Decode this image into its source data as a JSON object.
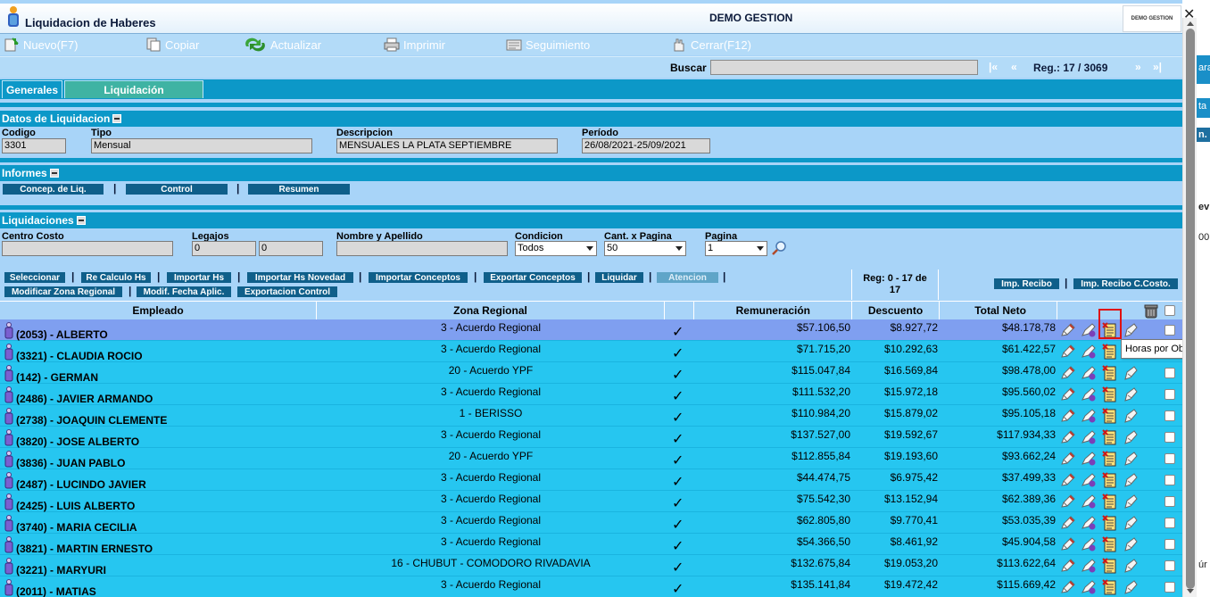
{
  "app": {
    "title": "Liquidacion de Haberes",
    "center_title": "DEMO GESTION",
    "brand": "DEMO GESTION"
  },
  "toolbar": [
    {
      "label": "Nuevo(F7)",
      "icon": "new-icon"
    },
    {
      "label": "Copiar",
      "icon": "copy-icon"
    },
    {
      "label": "Actualizar",
      "icon": "refresh-icon"
    },
    {
      "label": "Imprimir",
      "icon": "printer-icon"
    },
    {
      "label": "Seguimiento",
      "icon": "tracking-icon"
    },
    {
      "label": "Cerrar(F12)",
      "icon": "close-hand-icon"
    }
  ],
  "search": {
    "label": "Buscar",
    "value": "",
    "first": "|«",
    "prev": "«",
    "next": "»",
    "last": "»|",
    "reg": "Reg.: 17 / 3069"
  },
  "tabs": [
    "Generales",
    "Liquidación"
  ],
  "datos": {
    "header": "Datos de Liquidacion",
    "codigo_label": "Codigo",
    "codigo": "3301",
    "tipo_label": "Tipo",
    "tipo": "Mensual",
    "descripcion_label": "Descripcion",
    "descripcion": "MENSUALES LA PLATA SEPTIEMBRE",
    "periodo_label": "Período",
    "periodo": "26/08/2021-25/09/2021"
  },
  "informes": {
    "header": "Informes",
    "buttons": [
      "Concep. de Liq.",
      "Control",
      "Resumen"
    ],
    "sep": "|"
  },
  "liquidaciones": {
    "header": "Liquidaciones",
    "centro_costo_label": "Centro Costo",
    "centro_costo": "",
    "legajos_label": "Legajos",
    "legajo_desde": "0",
    "legajo_hasta": "0",
    "nombre_label": "Nombre y Apellido",
    "nombre": "",
    "condicion_label": "Condicion",
    "condicion": "Todos",
    "cant_label": "Cant. x Pagina",
    "cant": "50",
    "pagina_label": "Pagina",
    "pagina": "1"
  },
  "actions": {
    "row1": [
      "Seleccionar",
      "Re Calculo Hs",
      "Importar Hs",
      "Importar Hs Novedad",
      "Importar Conceptos",
      "Exportar Conceptos",
      "Liquidar",
      "Atencion"
    ],
    "row2": [
      "Modificar Zona Regional",
      "Modif. Fecha Aplic.",
      "Exportacion Control"
    ],
    "reg_line1": "Reg: 0 - 17 de",
    "reg_line2": "17",
    "recibo": "Imp. Recibo",
    "recibo_cc": "Imp. Recibo C.Costo."
  },
  "table": {
    "headers": {
      "empleado": "Empleado",
      "zona": "Zona Regional",
      "remuneracion": "Remuneración",
      "descuento": "Descuento",
      "total": "Total Neto"
    },
    "rows": [
      {
        "empleado": "(2053) - ALBERTO",
        "zona": "3 - Acuerdo Regional",
        "remuneracion": "$57.106,50",
        "descuento": "$8.927,72",
        "total": "$48.178,78"
      },
      {
        "empleado": "(3321) - CLAUDIA ROCIO",
        "zona": "3 - Acuerdo Regional",
        "remuneracion": "$71.715,20",
        "descuento": "$10.292,63",
        "total": "$61.422,57"
      },
      {
        "empleado": "(142) - GERMAN",
        "zona": "20 - Acuerdo YPF",
        "remuneracion": "$115.047,84",
        "descuento": "$16.569,84",
        "total": "$98.478,00"
      },
      {
        "empleado": "(2486) - JAVIER ARMANDO",
        "zona": "3 - Acuerdo Regional",
        "remuneracion": "$111.532,20",
        "descuento": "$15.972,18",
        "total": "$95.560,02"
      },
      {
        "empleado": "(2738) - JOAQUIN CLEMENTE",
        "zona": "1 - BERISSO",
        "remuneracion": "$110.984,20",
        "descuento": "$15.879,02",
        "total": "$95.105,18"
      },
      {
        "empleado": "(3820) - JOSE ALBERTO",
        "zona": "3 - Acuerdo Regional",
        "remuneracion": "$137.527,00",
        "descuento": "$19.592,67",
        "total": "$117.934,33"
      },
      {
        "empleado": "(3836) - JUAN PABLO",
        "zona": "20 - Acuerdo YPF",
        "remuneracion": "$112.855,84",
        "descuento": "$19.193,60",
        "total": "$93.662,24"
      },
      {
        "empleado": "(2487) - LUCINDO JAVIER",
        "zona": "3 - Acuerdo Regional",
        "remuneracion": "$44.474,75",
        "descuento": "$6.975,42",
        "total": "$37.499,33"
      },
      {
        "empleado": "(2425) - LUIS ALBERTO",
        "zona": "3 - Acuerdo Regional",
        "remuneracion": "$75.542,30",
        "descuento": "$13.152,94",
        "total": "$62.389,36"
      },
      {
        "empleado": "(3740) - MARIA CECILIA",
        "zona": "3 - Acuerdo Regional",
        "remuneracion": "$62.805,80",
        "descuento": "$9.770,41",
        "total": "$53.035,39"
      },
      {
        "empleado": "(3821) - MARTIN ERNESTO",
        "zona": "3 - Acuerdo Regional",
        "remuneracion": "$54.366,50",
        "descuento": "$8.461,92",
        "total": "$45.904,58"
      },
      {
        "empleado": "(3221) - MARYURI",
        "zona": "16 - CHUBUT - COMODORO RIVADAVIA",
        "remuneracion": "$132.675,84",
        "descuento": "$19.053,20",
        "total": "$113.622,64"
      },
      {
        "empleado": "(2011) - MATIAS",
        "zona": "3 - Acuerdo Regional",
        "remuneracion": "$135.141,84",
        "descuento": "$19.472,42",
        "total": "$115.669,42"
      }
    ]
  },
  "tooltip": "Horas por Obras",
  "close_glyph": "✕",
  "check_glyph": "✓",
  "behind_fragments": [
    "ara",
    "ta",
    "n.",
    "ev",
    "00",
    "úr"
  ],
  "colors": {
    "header_blue": "#0c98c8",
    "row_cyan": "#26c6f0",
    "selected_row": "#7f9ff0",
    "button_dark": "#0f5f8a",
    "highlight_red": "#e01010"
  }
}
